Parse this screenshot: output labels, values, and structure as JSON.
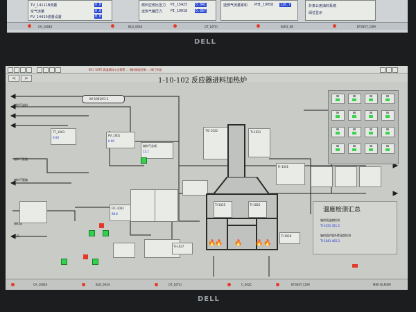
{
  "top_monitor": {
    "readouts": [
      {
        "label": "TV_14111B流量",
        "value": "0.0"
      },
      {
        "label": "空气流量",
        "value": "0.0"
      },
      {
        "label": "FV_14410流量设置",
        "value": "0.0"
      },
      {
        "label": "燃料空燃比压力",
        "value": "PI_15425",
        "reading": "0.841"
      },
      {
        "label": "送热气罐压力",
        "value": "PI_19018",
        "reading": "0.867"
      },
      {
        "label": "送燃气流量累积",
        "value": "PHI_19058",
        "reading": "128.7"
      },
      {
        "label": "HI_14",
        "value": ""
      }
    ],
    "right_labels": [
      "外来公用油料系统",
      "阀位显示"
    ],
    "tabs": [
      "CA_10040",
      "BLO_0034",
      "GT_10TCI",
      "B3R2_08",
      "BT30ST_COM"
    ],
    "status_right": "MRR DLPGIM",
    "brand": "DELL"
  },
  "main_monitor": {
    "title": "1-10-102 反应器进料加热炉",
    "nav_back": "<",
    "nav_forward": ">",
    "header_alarm": "BCI: SATE 高温燃料火灾报警 ... 燃料燃烧控制 ... 阀门开度",
    "left_labels": [
      "燃料气进料",
      "燃料气管道",
      "燃料气管路",
      "燃料油",
      "蒸汽"
    ],
    "top_vessel_label": "KA-1061A/1-1",
    "left_panel_labels": [
      "TT_1003",
      "PV_1001",
      "燃料气总线",
      "FIC-1002"
    ],
    "left_panel_values": [
      "0.00",
      "0.00",
      "12.1",
      "98.6"
    ],
    "center_label_1": "TIC-1022",
    "center_label_2": "TI-1021",
    "center_label_3": "FI-1041",
    "furnace_tags": [
      "TI-1025",
      "TI-1026",
      "TI-1027",
      "TI-1028"
    ],
    "summary_title": "温度检测汇总",
    "summary_lines": [
      "辐射段温度检测",
      "TI-1031 321.5",
      "辐射段炉管外壁温度检测",
      "TI-1041 465.3"
    ],
    "bottom_tabs": [
      "CA_10040",
      "BLO_0034",
      "GT_10TCI",
      "C_002C",
      "BT30ST_COM"
    ],
    "status_right": "MRR DLPGIM",
    "brand": "DELL",
    "colors": {
      "valve_green": "#2fd24a",
      "valve_red": "#e23a2a",
      "readout_blue": "#1b2dd0",
      "screen_bg": "#c9cbc6"
    }
  }
}
